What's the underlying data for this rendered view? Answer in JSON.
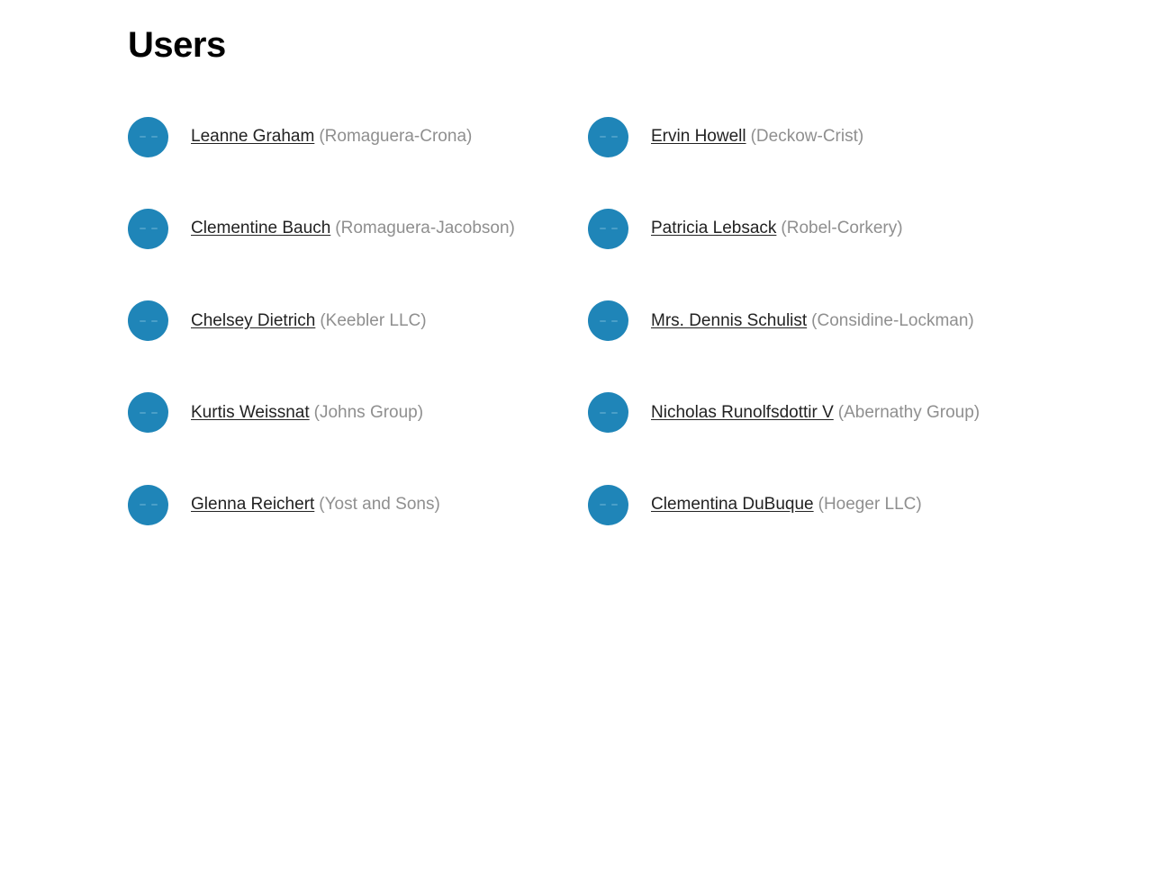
{
  "page": {
    "title": "Users"
  },
  "colors": {
    "avatar": "#1f85b8",
    "link": "#222222",
    "company": "#8f8f8f"
  },
  "users": [
    {
      "name": "Leanne Graham",
      "company": "(Romaguera-Crona)"
    },
    {
      "name": "Ervin Howell",
      "company": "(Deckow-Crist)"
    },
    {
      "name": "Clementine Bauch",
      "company": "(Romaguera-Jacobson)"
    },
    {
      "name": "Patricia Lebsack",
      "company": "(Robel-Corkery)"
    },
    {
      "name": "Chelsey Dietrich",
      "company": "(Keebler LLC)"
    },
    {
      "name": "Mrs. Dennis Schulist",
      "company": "(Considine-Lockman)"
    },
    {
      "name": "Kurtis Weissnat",
      "company": "(Johns Group)"
    },
    {
      "name": "Nicholas Runolfsdottir V",
      "company": "(Abernathy Group)"
    },
    {
      "name": "Glenna Reichert",
      "company": "(Yost and Sons)"
    },
    {
      "name": "Clementina DuBuque",
      "company": "(Hoeger LLC)"
    }
  ]
}
